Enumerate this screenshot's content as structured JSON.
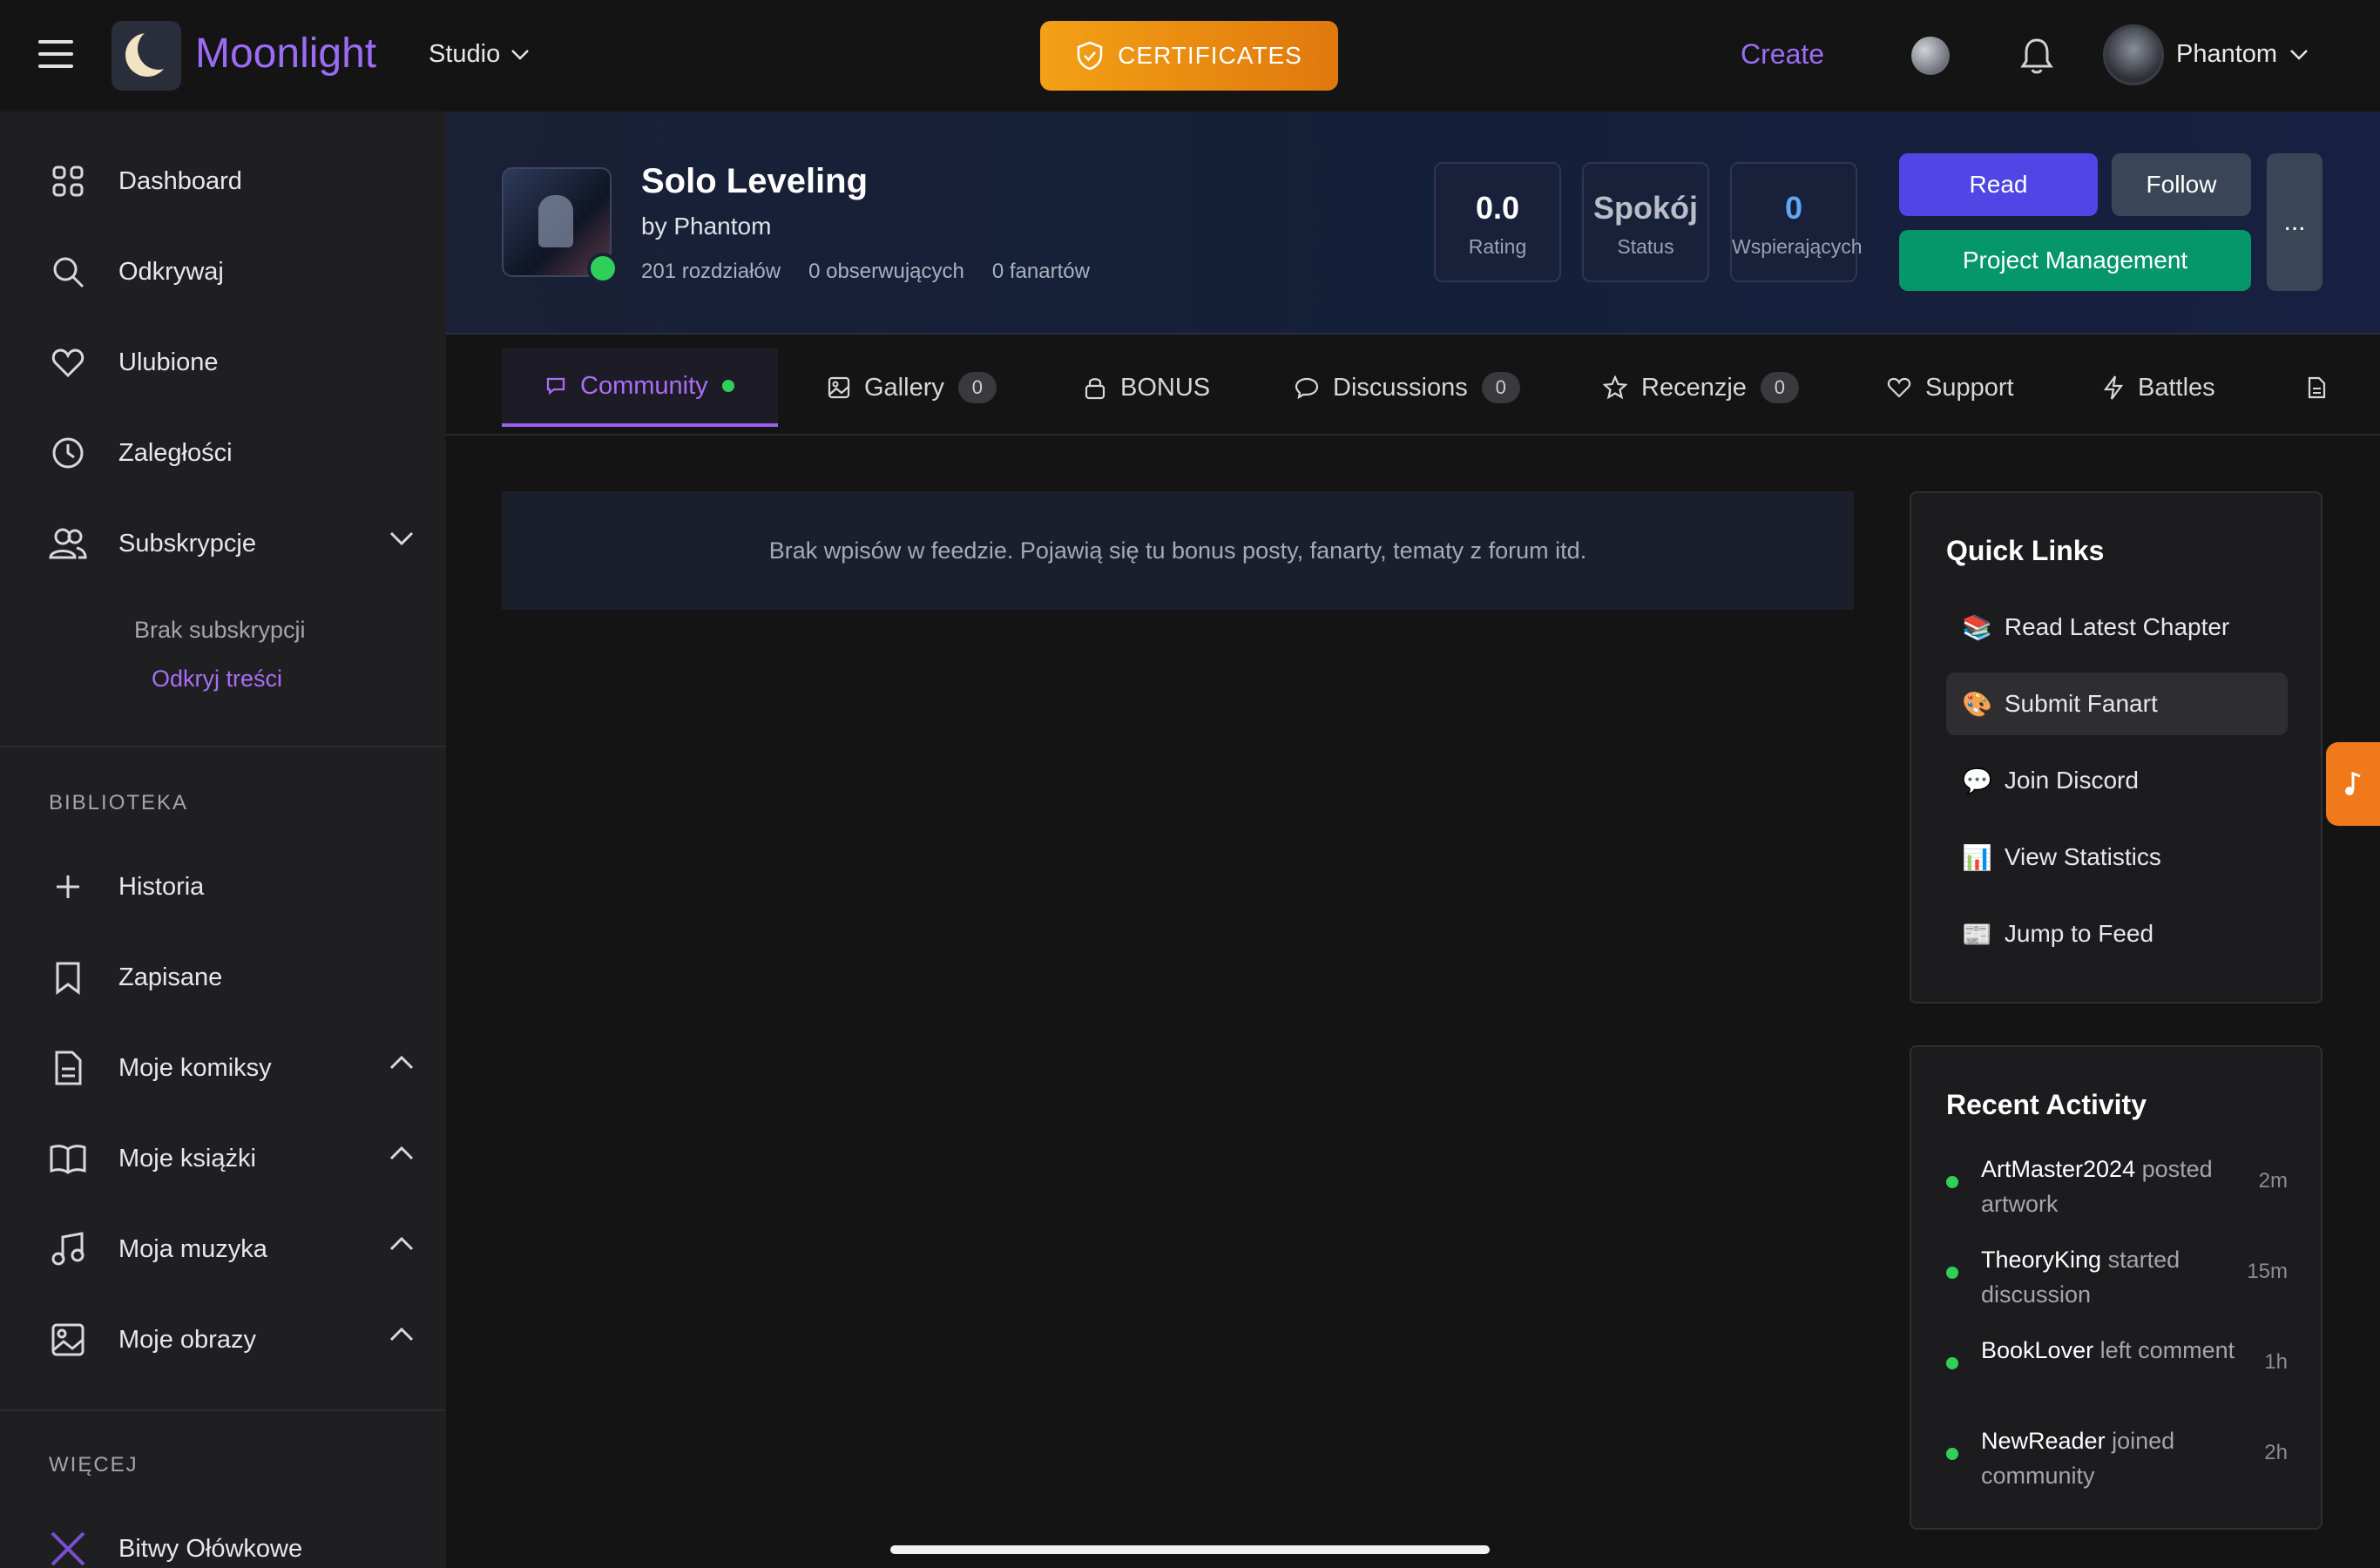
{
  "app": {
    "name": "Moonlight",
    "studio_label": "Studio"
  },
  "top": {
    "certificates_label": "CERTIFICATES",
    "create_label": "Create",
    "user_name": "Phantom"
  },
  "sidebar": {
    "items": [
      {
        "label": "Dashboard",
        "icon": "dashboard-icon"
      },
      {
        "label": "Odkrywaj",
        "icon": "search-icon"
      },
      {
        "label": "Ulubione",
        "icon": "heart-icon"
      },
      {
        "label": "Zaległości",
        "icon": "clock-icon"
      },
      {
        "label": "Subskrypcje",
        "icon": "users-icon"
      }
    ],
    "subs_empty": "Brak subskrypcji",
    "subs_discover": "Odkryj treści",
    "library_label": "BIBLIOTEKA",
    "library": [
      {
        "label": "Historia",
        "icon": "plus-icon"
      },
      {
        "label": "Zapisane",
        "icon": "bookmark-icon"
      },
      {
        "label": "Moje komiksy",
        "icon": "document-icon"
      },
      {
        "label": "Moje książki",
        "icon": "book-icon"
      },
      {
        "label": "Moja muzyka",
        "icon": "music-icon"
      },
      {
        "label": "Moje obrazy",
        "icon": "image-icon"
      }
    ],
    "more_label": "WIĘCEJ",
    "more": [
      {
        "label": "Bitwy Ołówkowe",
        "icon": "swords-icon"
      }
    ]
  },
  "project": {
    "title": "Solo Leveling",
    "byline": "by Phantom",
    "chapters": "201 rozdziałów",
    "followers": "0 obserwujących",
    "fans": "0 fanartów",
    "stats": [
      {
        "value": "0.0",
        "label": "Rating"
      },
      {
        "value": "Spokój",
        "label": "Status"
      },
      {
        "value": "0",
        "label": "Wspierających"
      }
    ],
    "read_label": "Read",
    "follow_label": "Follow",
    "manage_label": "Project Management",
    "more_label": "..."
  },
  "tabs": [
    {
      "label": "Community"
    },
    {
      "label": "Gallery",
      "count": "0"
    },
    {
      "label": "BONUS"
    },
    {
      "label": "Discussions",
      "count": "0"
    },
    {
      "label": "Recenzje",
      "count": "0"
    },
    {
      "label": "Support"
    },
    {
      "label": "Battles"
    }
  ],
  "feed": {
    "empty_text": "Brak wpisów w feedzie. Pojawią się tu bonus posty, fanarty, tematy z forum itd."
  },
  "quick_links": {
    "title": "Quick Links",
    "items": [
      {
        "emoji": "📚",
        "label": "Read Latest Chapter"
      },
      {
        "emoji": "🎨",
        "label": "Submit Fanart"
      },
      {
        "emoji": "💬",
        "label": "Join Discord"
      },
      {
        "emoji": "📊",
        "label": "View Statistics"
      },
      {
        "emoji": "📰",
        "label": "Jump to Feed"
      }
    ]
  },
  "recent_activity": {
    "title": "Recent Activity",
    "items": [
      {
        "user": "ArtMaster2024",
        "action": "posted artwork",
        "time": "2m"
      },
      {
        "user": "TheoryKing",
        "action": "started discussion",
        "time": "15m"
      },
      {
        "user": "BookLover",
        "action": "left comment",
        "time": "1h"
      },
      {
        "user": "NewReader",
        "action": "joined community",
        "time": "2h"
      }
    ]
  },
  "colors": {
    "accent": "#9b6cf5",
    "read_button": "#4f46e5",
    "manage_button": "#059669",
    "online": "#2fcf5a",
    "certificates": "#f3a115",
    "fab": "#f07a1a"
  }
}
